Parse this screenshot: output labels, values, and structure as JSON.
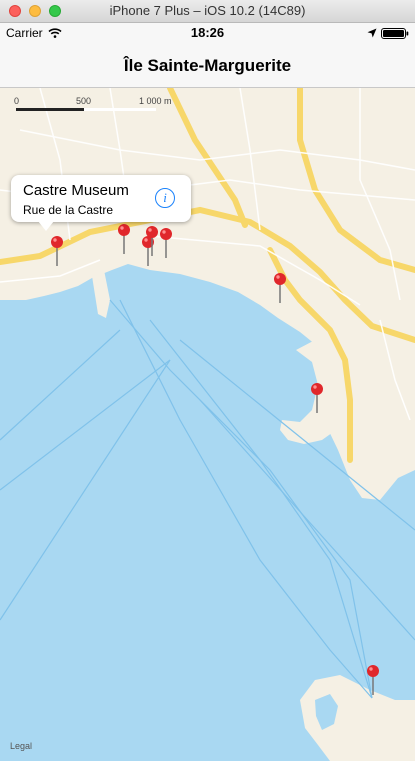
{
  "window": {
    "title": "iPhone 7 Plus – iOS 10.2 (14C89)"
  },
  "status_bar": {
    "carrier": "Carrier",
    "time": "18:26"
  },
  "nav": {
    "title": "Île Sainte-Marguerite"
  },
  "map": {
    "scale": {
      "label_0": "0",
      "label_500": "500",
      "label_1000": "1 000 m"
    },
    "callout": {
      "title": "Castre Museum",
      "subtitle": "Rue de la Castre"
    },
    "legal": "Legal",
    "colors": {
      "water": "#a9d8f2",
      "land": "#f5f0e4",
      "road": "#f7d76a",
      "pin": "#e0272b"
    }
  }
}
